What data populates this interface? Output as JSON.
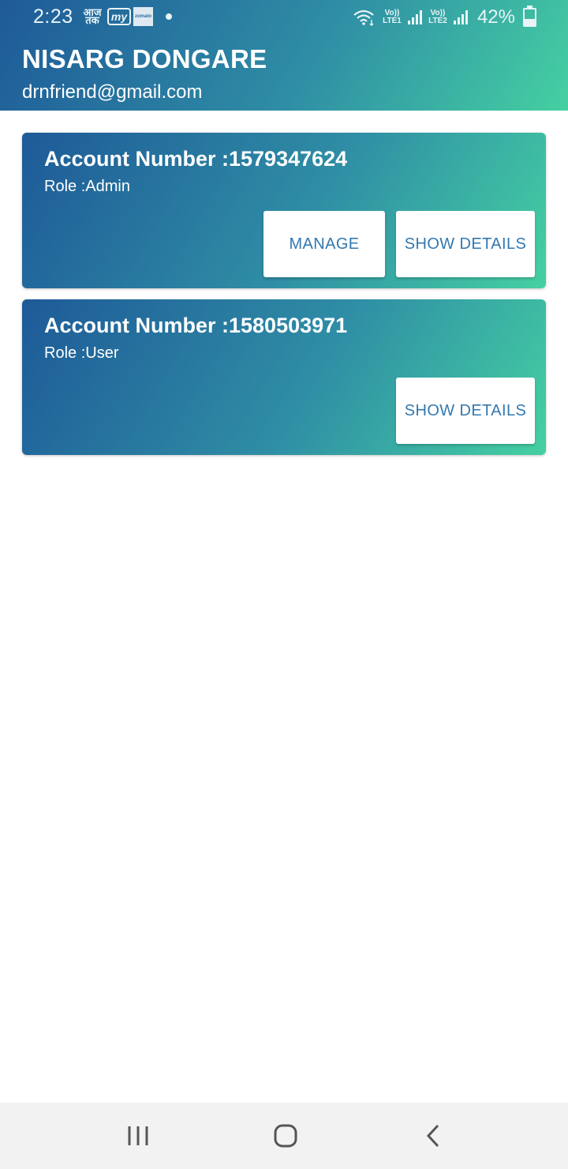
{
  "status_bar": {
    "time": "2:23",
    "app_icons": [
      "aaj-tak-icon",
      "myntra-icon",
      "zomato-icon"
    ],
    "aaj_tak_text": "आज तक",
    "myntra_text": "my",
    "zomato_text": "zomato",
    "sim1_label": "Vo)) LTE1",
    "sim2_label": "Vo)) LTE2",
    "battery_percent": "42%",
    "battery_level": 0.42
  },
  "header": {
    "name": "NISARG DONGARE",
    "email": "drnfriend@gmail.com"
  },
  "accounts": [
    {
      "title": "Account Number :1579347624",
      "role": "Role :Admin",
      "manage_label": "MANAGE",
      "details_label": "SHOW DETAILS"
    },
    {
      "title": "Account Number :1580503971",
      "role": "Role :User",
      "details_label": "SHOW DETAILS"
    }
  ],
  "nav_bar": {
    "icons": [
      "recent-apps-icon",
      "home-icon",
      "back-icon"
    ]
  },
  "colors": {
    "gradient_start": "#1e5a98",
    "gradient_end": "#45d0a2",
    "button_text": "#3278b1"
  }
}
